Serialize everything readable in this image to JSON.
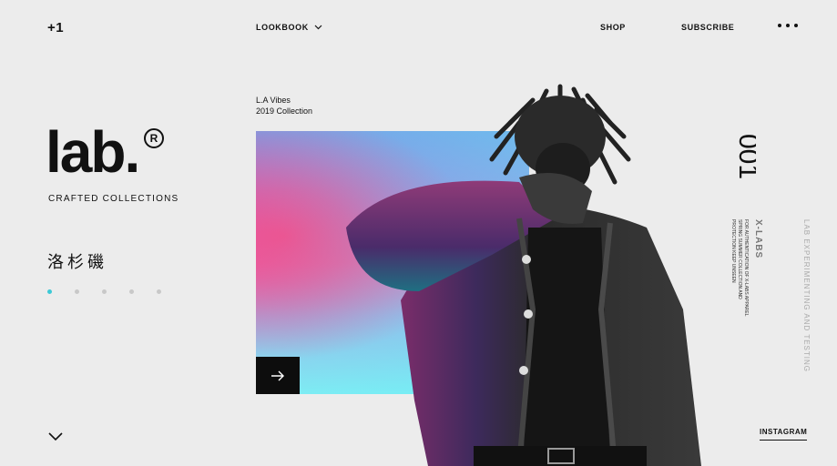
{
  "header": {
    "logo_mark": "+1",
    "nav_lookbook": "LOOKBOOK",
    "nav_shop": "SHOP",
    "nav_subscribe": "SUBSCRIBE"
  },
  "brand": {
    "word": "lab.",
    "registered": "R",
    "tagline": "CRAFTED COLLECTIONS",
    "city": "洛杉磯"
  },
  "slider": {
    "dot_count": 5,
    "active_index": 0
  },
  "collection": {
    "line1": "L.A Vibes",
    "line2": "2019 Collection"
  },
  "side": {
    "number": "001",
    "xlabs": "X-LABS",
    "small_text": "FOR AUTHENTICATION OF X-LABS APPAREL SPRING SUMMER COLLECTION AND PROTECTION KEEP UNSEEN",
    "experiment": "LAB EXPERIMENTING AND TESTING"
  },
  "footer": {
    "instagram": "INSTAGRAM"
  },
  "colors": {
    "accent": "#3cc9d6",
    "background": "#ececec",
    "ink": "#111111"
  }
}
